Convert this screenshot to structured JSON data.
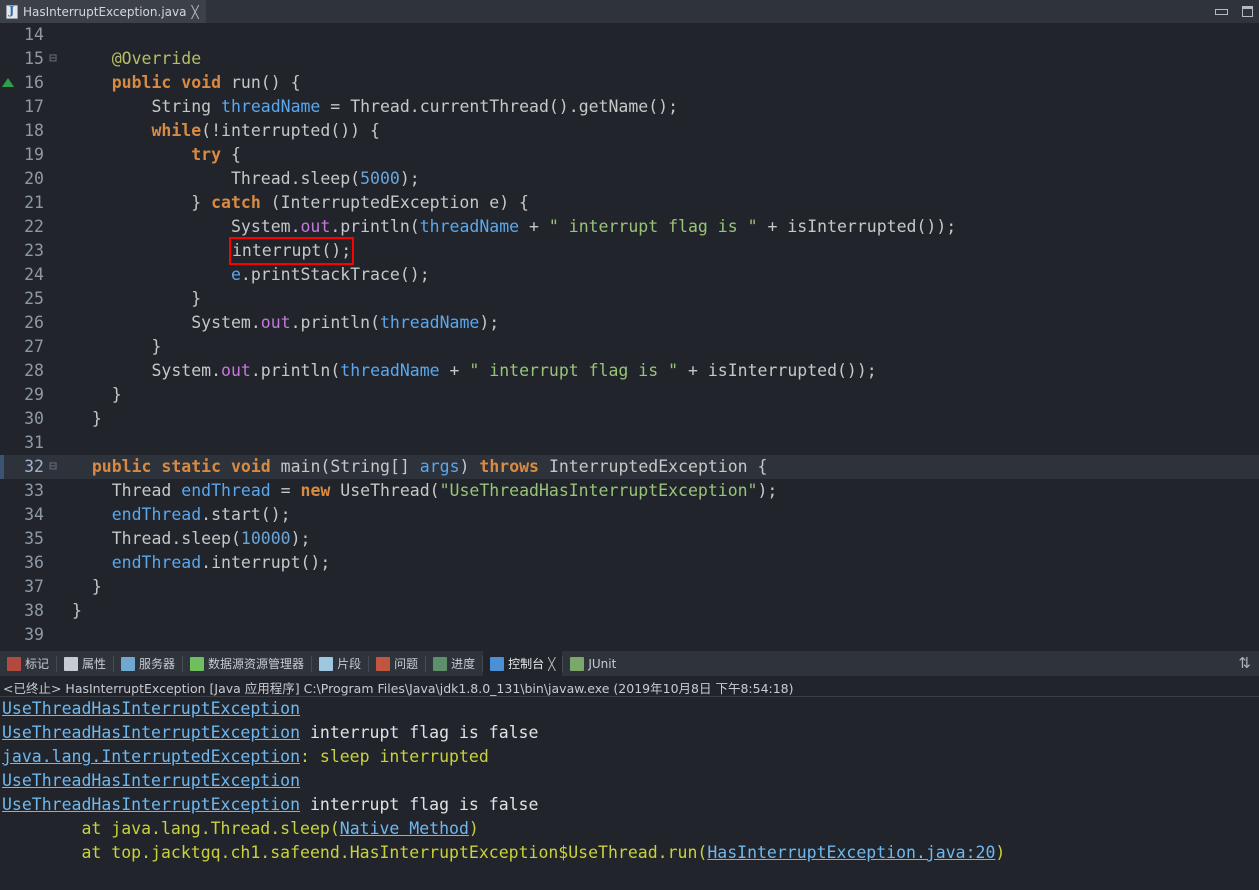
{
  "window": {
    "min_icon": "minimize-icon",
    "max_icon": "maximize-icon"
  },
  "editor_tab": {
    "icon": "java-file-icon",
    "title": "HasInterruptException.java",
    "close": "╳"
  },
  "editor": {
    "lines": [
      {
        "n": "14",
        "fold": "",
        "marker": false,
        "current": false,
        "tokens": []
      },
      {
        "n": "15",
        "fold": "⊟",
        "marker": false,
        "current": false,
        "tokens": [
          {
            "t": "plain",
            "v": "    "
          },
          {
            "t": "ann",
            "v": "@Override"
          }
        ]
      },
      {
        "n": "16",
        "fold": "",
        "marker": true,
        "current": false,
        "tokens": [
          {
            "t": "plain",
            "v": "    "
          },
          {
            "t": "kw",
            "v": "public"
          },
          {
            "t": "plain",
            "v": " "
          },
          {
            "t": "kw",
            "v": "void"
          },
          {
            "t": "plain",
            "v": " "
          },
          {
            "t": "mth",
            "v": "run"
          },
          {
            "t": "punct",
            "v": "() {"
          }
        ]
      },
      {
        "n": "17",
        "fold": "",
        "marker": false,
        "current": false,
        "tokens": [
          {
            "t": "plain",
            "v": "        "
          },
          {
            "t": "type",
            "v": "String"
          },
          {
            "t": "plain",
            "v": " "
          },
          {
            "t": "var",
            "v": "threadName"
          },
          {
            "t": "punct",
            "v": " = "
          },
          {
            "t": "type",
            "v": "Thread"
          },
          {
            "t": "punct",
            "v": "."
          },
          {
            "t": "mth",
            "v": "currentThread"
          },
          {
            "t": "punct",
            "v": "()."
          },
          {
            "t": "mth",
            "v": "getName"
          },
          {
            "t": "punct",
            "v": "();"
          }
        ]
      },
      {
        "n": "18",
        "fold": "",
        "marker": false,
        "current": false,
        "tokens": [
          {
            "t": "plain",
            "v": "        "
          },
          {
            "t": "kw",
            "v": "while"
          },
          {
            "t": "punct",
            "v": "(!"
          },
          {
            "t": "mth",
            "v": "interrupted"
          },
          {
            "t": "punct",
            "v": "()) {"
          }
        ]
      },
      {
        "n": "19",
        "fold": "",
        "marker": false,
        "current": false,
        "tokens": [
          {
            "t": "plain",
            "v": "            "
          },
          {
            "t": "kw",
            "v": "try"
          },
          {
            "t": "punct",
            "v": " {"
          }
        ]
      },
      {
        "n": "20",
        "fold": "",
        "marker": false,
        "current": false,
        "tokens": [
          {
            "t": "plain",
            "v": "                "
          },
          {
            "t": "type",
            "v": "Thread"
          },
          {
            "t": "punct",
            "v": "."
          },
          {
            "t": "mth",
            "v": "sleep"
          },
          {
            "t": "punct",
            "v": "("
          },
          {
            "t": "num",
            "v": "5000"
          },
          {
            "t": "punct",
            "v": ");"
          }
        ]
      },
      {
        "n": "21",
        "fold": "",
        "marker": false,
        "current": false,
        "tokens": [
          {
            "t": "plain",
            "v": "            } "
          },
          {
            "t": "kw",
            "v": "catch"
          },
          {
            "t": "punct",
            "v": " ("
          },
          {
            "t": "type",
            "v": "InterruptedException"
          },
          {
            "t": "plain",
            "v": " e"
          },
          {
            "t": "punct",
            "v": ") {"
          }
        ]
      },
      {
        "n": "22",
        "fold": "",
        "marker": false,
        "current": false,
        "tokens": [
          {
            "t": "plain",
            "v": "                "
          },
          {
            "t": "type",
            "v": "System"
          },
          {
            "t": "punct",
            "v": "."
          },
          {
            "t": "fld",
            "v": "out"
          },
          {
            "t": "punct",
            "v": "."
          },
          {
            "t": "mth",
            "v": "println"
          },
          {
            "t": "punct",
            "v": "("
          },
          {
            "t": "var",
            "v": "threadName"
          },
          {
            "t": "punct",
            "v": " + "
          },
          {
            "t": "str",
            "v": "\" interrupt flag is \""
          },
          {
            "t": "punct",
            "v": " + "
          },
          {
            "t": "mth",
            "v": "isInterrupted"
          },
          {
            "t": "punct",
            "v": "());"
          }
        ]
      },
      {
        "n": "23",
        "fold": "",
        "marker": false,
        "current": false,
        "boxed": true,
        "tokens": [
          {
            "t": "plain",
            "v": "                "
          },
          {
            "t": "box",
            "v": [
              {
                "t": "mth",
                "v": "interrupt"
              },
              {
                "t": "punct",
                "v": "();"
              }
            ]
          }
        ]
      },
      {
        "n": "24",
        "fold": "",
        "marker": false,
        "current": false,
        "tokens": [
          {
            "t": "plain",
            "v": "                "
          },
          {
            "t": "var",
            "v": "e"
          },
          {
            "t": "punct",
            "v": "."
          },
          {
            "t": "mth",
            "v": "printStackTrace"
          },
          {
            "t": "punct",
            "v": "();"
          }
        ]
      },
      {
        "n": "25",
        "fold": "",
        "marker": false,
        "current": false,
        "tokens": [
          {
            "t": "punct",
            "v": "            }"
          }
        ]
      },
      {
        "n": "26",
        "fold": "",
        "marker": false,
        "current": false,
        "tokens": [
          {
            "t": "plain",
            "v": "            "
          },
          {
            "t": "type",
            "v": "System"
          },
          {
            "t": "punct",
            "v": "."
          },
          {
            "t": "fld",
            "v": "out"
          },
          {
            "t": "punct",
            "v": "."
          },
          {
            "t": "mth",
            "v": "println"
          },
          {
            "t": "punct",
            "v": "("
          },
          {
            "t": "var",
            "v": "threadName"
          },
          {
            "t": "punct",
            "v": ");"
          }
        ]
      },
      {
        "n": "27",
        "fold": "",
        "marker": false,
        "current": false,
        "tokens": [
          {
            "t": "punct",
            "v": "        }"
          }
        ]
      },
      {
        "n": "28",
        "fold": "",
        "marker": false,
        "current": false,
        "tokens": [
          {
            "t": "plain",
            "v": "        "
          },
          {
            "t": "type",
            "v": "System"
          },
          {
            "t": "punct",
            "v": "."
          },
          {
            "t": "fld",
            "v": "out"
          },
          {
            "t": "punct",
            "v": "."
          },
          {
            "t": "mth",
            "v": "println"
          },
          {
            "t": "punct",
            "v": "("
          },
          {
            "t": "var",
            "v": "threadName"
          },
          {
            "t": "punct",
            "v": " + "
          },
          {
            "t": "str",
            "v": "\" interrupt flag is \""
          },
          {
            "t": "punct",
            "v": " + "
          },
          {
            "t": "mth",
            "v": "isInterrupted"
          },
          {
            "t": "punct",
            "v": "());"
          }
        ]
      },
      {
        "n": "29",
        "fold": "",
        "marker": false,
        "current": false,
        "tokens": [
          {
            "t": "punct",
            "v": "    }"
          }
        ]
      },
      {
        "n": "30",
        "fold": "",
        "marker": false,
        "current": false,
        "tokens": [
          {
            "t": "punct",
            "v": "  }"
          }
        ]
      },
      {
        "n": "31",
        "fold": "",
        "marker": false,
        "current": false,
        "tokens": []
      },
      {
        "n": "32",
        "fold": "⊟",
        "marker": false,
        "current": true,
        "tokens": [
          {
            "t": "plain",
            "v": "  "
          },
          {
            "t": "kw",
            "v": "public"
          },
          {
            "t": "plain",
            "v": " "
          },
          {
            "t": "kw",
            "v": "static"
          },
          {
            "t": "plain",
            "v": " "
          },
          {
            "t": "kw",
            "v": "void"
          },
          {
            "t": "plain",
            "v": " "
          },
          {
            "t": "mth",
            "v": "main"
          },
          {
            "t": "punct",
            "v": "("
          },
          {
            "t": "type",
            "v": "String[]"
          },
          {
            "t": "plain",
            "v": " "
          },
          {
            "t": "var",
            "v": "args"
          },
          {
            "t": "punct",
            "v": ") "
          },
          {
            "t": "kw",
            "v": "throws"
          },
          {
            "t": "plain",
            "v": " "
          },
          {
            "t": "type",
            "v": "InterruptedException"
          },
          {
            "t": "punct",
            "v": " {"
          }
        ]
      },
      {
        "n": "33",
        "fold": "",
        "marker": false,
        "current": false,
        "tokens": [
          {
            "t": "plain",
            "v": "    "
          },
          {
            "t": "type",
            "v": "Thread"
          },
          {
            "t": "plain",
            "v": " "
          },
          {
            "t": "var",
            "v": "endThread"
          },
          {
            "t": "punct",
            "v": " = "
          },
          {
            "t": "kw",
            "v": "new"
          },
          {
            "t": "plain",
            "v": " "
          },
          {
            "t": "type",
            "v": "UseThread"
          },
          {
            "t": "punct",
            "v": "("
          },
          {
            "t": "str",
            "v": "\"UseThreadHasInterruptException\""
          },
          {
            "t": "punct",
            "v": ");"
          }
        ]
      },
      {
        "n": "34",
        "fold": "",
        "marker": false,
        "current": false,
        "tokens": [
          {
            "t": "plain",
            "v": "    "
          },
          {
            "t": "var",
            "v": "endThread"
          },
          {
            "t": "punct",
            "v": "."
          },
          {
            "t": "mth",
            "v": "start"
          },
          {
            "t": "punct",
            "v": "();"
          }
        ]
      },
      {
        "n": "35",
        "fold": "",
        "marker": false,
        "current": false,
        "tokens": [
          {
            "t": "plain",
            "v": "    "
          },
          {
            "t": "type",
            "v": "Thread"
          },
          {
            "t": "punct",
            "v": "."
          },
          {
            "t": "mth",
            "v": "sleep"
          },
          {
            "t": "punct",
            "v": "("
          },
          {
            "t": "num",
            "v": "10000"
          },
          {
            "t": "punct",
            "v": ");"
          }
        ]
      },
      {
        "n": "36",
        "fold": "",
        "marker": false,
        "current": false,
        "tokens": [
          {
            "t": "plain",
            "v": "    "
          },
          {
            "t": "var",
            "v": "endThread"
          },
          {
            "t": "punct",
            "v": "."
          },
          {
            "t": "mth",
            "v": "interrupt"
          },
          {
            "t": "punct",
            "v": "();"
          }
        ]
      },
      {
        "n": "37",
        "fold": "",
        "marker": false,
        "current": false,
        "tokens": [
          {
            "t": "punct",
            "v": "  }"
          }
        ]
      },
      {
        "n": "38",
        "fold": "",
        "marker": false,
        "current": false,
        "tokens": [
          {
            "t": "punct",
            "v": "}"
          }
        ]
      },
      {
        "n": "39",
        "fold": "",
        "marker": false,
        "current": false,
        "tokens": []
      }
    ]
  },
  "view_tabs": {
    "items": [
      {
        "label": "标记",
        "icon": "marker-icon",
        "color": "#b24a3f",
        "active": false
      },
      {
        "label": "属性",
        "icon": "properties-icon",
        "color": "#c7ccd4",
        "active": false
      },
      {
        "label": "服务器",
        "icon": "servers-icon",
        "color": "#6fa8d0",
        "active": false
      },
      {
        "label": "数据源资源管理器",
        "icon": "datasource-icon",
        "color": "#6fbf5f",
        "active": false
      },
      {
        "label": "片段",
        "icon": "snippets-icon",
        "color": "#9fc7e0",
        "active": false
      },
      {
        "label": "问题",
        "icon": "problems-icon",
        "color": "#c0563f",
        "active": false
      },
      {
        "label": "进度",
        "icon": "progress-icon",
        "color": "#5e8f6b",
        "active": false
      },
      {
        "label": "控制台",
        "icon": "console-icon",
        "color": "#4b8fd6",
        "active": true
      },
      {
        "label": "JUnit",
        "icon": "junit-icon",
        "color": "#7aa86a",
        "active": false
      }
    ],
    "right_icon": "restore-view-icon"
  },
  "console": {
    "status_line": "<已终止> HasInterruptException [Java 应用程序] C:\\Program Files\\Java\\jdk1.8.0_131\\bin\\javaw.exe  (2019年10月8日 下午8:54:18)",
    "output": [
      [
        {
          "t": "link",
          "v": "UseThreadHasInterruptException"
        }
      ],
      [
        {
          "t": "link",
          "v": "UseThreadHasInterruptException"
        },
        {
          "t": "out",
          "v": " interrupt flag is false"
        }
      ],
      [
        {
          "t": "link",
          "v": "java.lang.InterruptedException"
        },
        {
          "t": "err",
          "v": ": sleep interrupted"
        }
      ],
      [
        {
          "t": "link",
          "v": "UseThreadHasInterruptException"
        }
      ],
      [
        {
          "t": "link",
          "v": "UseThreadHasInterruptException"
        },
        {
          "t": "out",
          "v": " interrupt flag is false"
        }
      ],
      [
        {
          "t": "err",
          "v": "\tat java.lang.Thread.sleep("
        },
        {
          "t": "link",
          "v": "Native Method"
        },
        {
          "t": "err",
          "v": ")"
        }
      ],
      [
        {
          "t": "err",
          "v": "\tat top.jacktgq.ch1.safeend.HasInterruptException$UseThread.run("
        },
        {
          "t": "link",
          "v": "HasInterruptException.java:20"
        },
        {
          "t": "err",
          "v": ")"
        }
      ]
    ]
  }
}
